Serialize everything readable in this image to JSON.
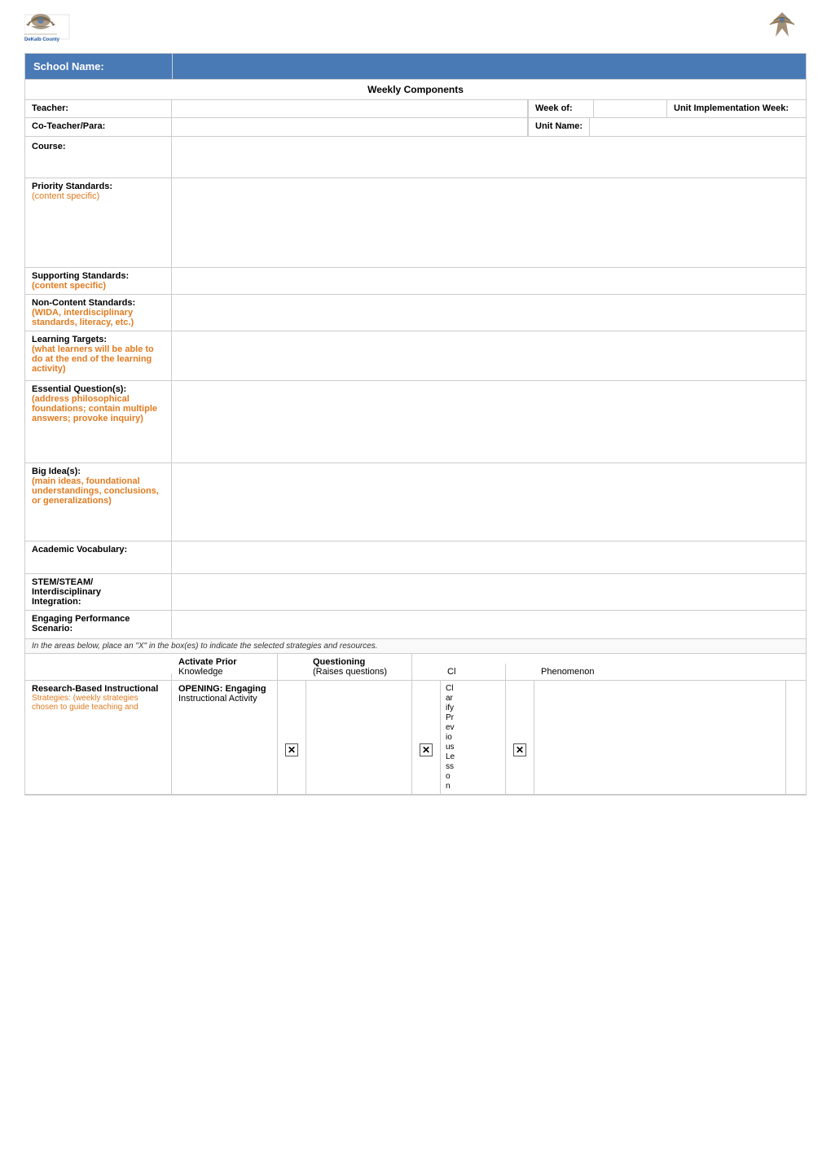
{
  "header": {
    "logo_left_text": "DeKalb County",
    "logo_right_text": "Logo"
  },
  "school_name": {
    "label": "School Name:",
    "value": ""
  },
  "weekly_components": {
    "title": "Weekly Components"
  },
  "teacher_section": {
    "teacher_label": "Teacher:",
    "coteacher_label": "Co-Teacher/Para:",
    "teacher_value": "",
    "coteacher_value": "",
    "week_of_label": "Week of:",
    "week_of_value": "",
    "unit_impl_label": "Unit Implementation Week:",
    "unit_impl_value": "",
    "unit_name_label": "Unit Name:",
    "unit_name_value": ""
  },
  "course": {
    "label": "Course:",
    "value": ""
  },
  "priority_standards": {
    "label": "Priority Standards:",
    "sub_label": "(content specific)",
    "value": ""
  },
  "supporting_standards": {
    "label": "Supporting Standards:",
    "sub_label": "(content specific)",
    "value": ""
  },
  "non_content_standards": {
    "label": "Non-Content Standards:",
    "sub_label": "(WIDA, interdisciplinary standards, literacy, etc.)",
    "value": ""
  },
  "learning_targets": {
    "label": "Learning Targets:",
    "sub_label": "(what learners will be able to do at the end of the learning activity)",
    "value": ""
  },
  "essential_question": {
    "label": "Essential Question(s):",
    "sub_label": "(address philosophical foundations; contain multiple answers; provoke inquiry)",
    "value": ""
  },
  "big_idea": {
    "label": "Big Idea(s):",
    "sub_label": "(main ideas, foundational understandings, conclusions, or generalizations)",
    "value": ""
  },
  "academic_vocabulary": {
    "label": "Academic Vocabulary:",
    "value": ""
  },
  "stem": {
    "label1": "STEM/STEAM/",
    "label2": "Interdisciplinary",
    "label3": "Integration:",
    "value": ""
  },
  "engaging_performance": {
    "label1": "Engaging Performance",
    "label2": "Scenario:",
    "value": ""
  },
  "instruction_note": "In the areas below, place an \"X\" in the box(es) to indicate the selected strategies and resources.",
  "strategies": {
    "opening_label": "OPENING: Engaging",
    "opening_sub": "Instructional Activity",
    "activate_prior_label": "Activate Prior",
    "activate_prior_sub": "Knowledge",
    "activate_checked": false,
    "questioning_label": "Questioning",
    "questioning_sub": "(Raises questions)",
    "questioning_checked": false,
    "clarify_label": "Cl",
    "clarify_items": [
      "ar",
      "ify",
      "Pr",
      "ev",
      "io",
      "us",
      "Le",
      "ss",
      "o",
      "n"
    ],
    "clarify_checked": true,
    "checkbox2_checked": true,
    "checkbox3_checked": true,
    "phenomenon_label": "Phenomenon",
    "phenomenon_checked": false
  },
  "research_based": {
    "title": "Research-Based Instructional",
    "sub1": "Strategies: (weekly strategies",
    "sub2": "chosen to guide teaching and"
  }
}
